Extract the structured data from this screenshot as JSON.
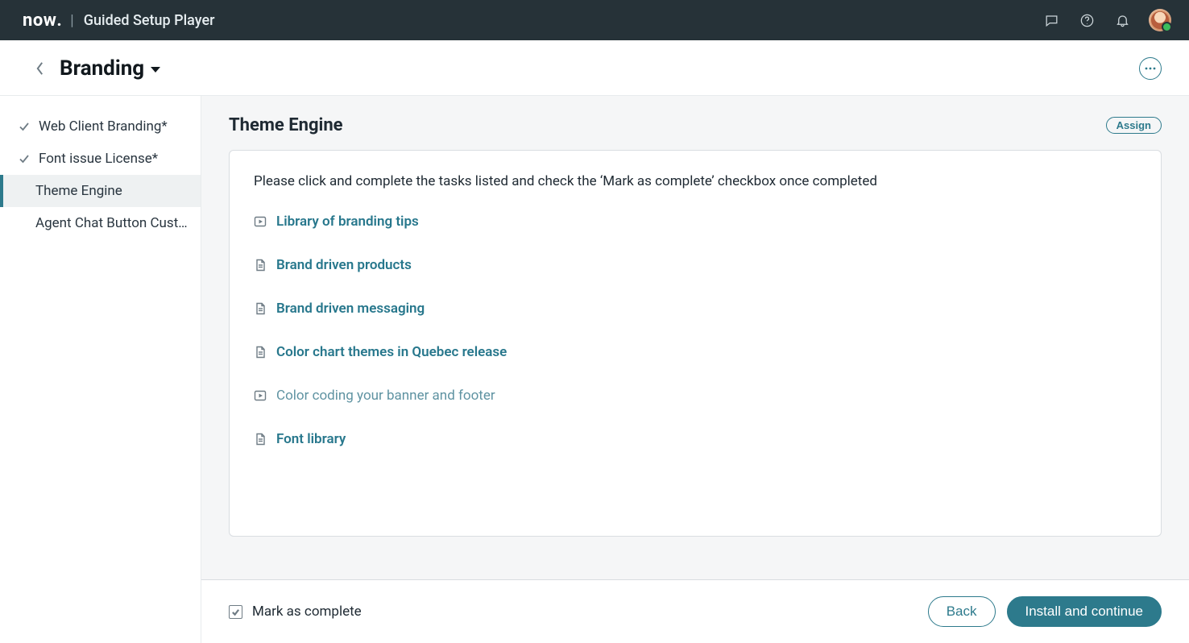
{
  "header": {
    "logo_text": "now",
    "app_title": "Guided Setup Player"
  },
  "subheader": {
    "page_title": "Branding"
  },
  "sidebar": {
    "items": [
      {
        "label": "Web Client Branding*",
        "completed": true,
        "active": false
      },
      {
        "label": "Font issue License*",
        "completed": true,
        "active": false
      },
      {
        "label": "Theme Engine",
        "completed": false,
        "active": true
      },
      {
        "label": "Agent Chat Button Cust…",
        "completed": false,
        "active": false
      }
    ]
  },
  "main": {
    "section_title": "Theme Engine",
    "assign_label": "Assign",
    "intro_text": "Please click and complete the tasks listed and check the ‘Mark as complete’ checkbox once completed",
    "tasks": [
      {
        "icon": "play",
        "label": "Library of branding tips",
        "muted": false
      },
      {
        "icon": "doc",
        "label": "Brand driven products",
        "muted": false
      },
      {
        "icon": "doc",
        "label": "Brand driven messaging",
        "muted": false
      },
      {
        "icon": "doc",
        "label": "Color chart themes in Quebec release",
        "muted": false
      },
      {
        "icon": "play",
        "label": "Color coding your banner and footer",
        "muted": true
      },
      {
        "icon": "doc",
        "label": "Font library",
        "muted": false
      }
    ]
  },
  "footer": {
    "mark_complete_label": "Mark as complete",
    "mark_complete_checked": true,
    "back_label": "Back",
    "continue_label": "Install and continue"
  }
}
